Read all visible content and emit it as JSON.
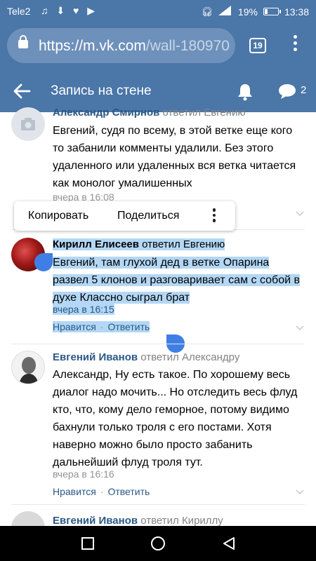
{
  "status_bar": {
    "carrier": "Tele2",
    "battery": "19%",
    "time": "13:38"
  },
  "browser": {
    "url_host": "https://m.vk.com",
    "url_path": "/wall-180970",
    "tab_count": "19"
  },
  "header": {
    "title": "Запись на стене",
    "messages_count": "2"
  },
  "comments": [
    {
      "author": "Александр Смирнов",
      "replied": "ответил Евгению",
      "text": "Евгений, судя по всему, в этой ветке еще кого то забанили комменты удалили. Без этого удаленного или удаленных вся ветка читается как монолог умалишенных",
      "date": "вчера в 16:08"
    },
    {
      "author": "Кирилл Елисеев",
      "replied": "ответил Евгению",
      "text": "Евгений, там глухой дед в ветке Опарина развел 5 клонов и разговаривает сам с собой в духе Классно сыграл брат",
      "date": "вчера в 16:15",
      "like": "Нравится",
      "reply": "Ответить"
    },
    {
      "author": "Евгений Иванов",
      "replied": "ответил Александру",
      "text": "Александр, Ну есть такое. По хорошему весь диалог надо мочить... Но отследить весь флуд кто, что, кому дело геморное, потому видимо бахнули только троля с его постами. Хотя наверно можно было просто забанить дальнейший флуд троля тут.",
      "date": "вчера в 16:16",
      "like": "Нравится",
      "reply": "Ответить"
    },
    {
      "author": "Евгений Иванов",
      "replied": "ответил Кириллу"
    }
  ],
  "context_menu": {
    "copy": "Копировать",
    "share": "Поделиться"
  },
  "colors": {
    "brand": "#4a76a8",
    "link": "#2a5885",
    "selection": "#b3d7f5",
    "handle": "#3f7fe5"
  }
}
